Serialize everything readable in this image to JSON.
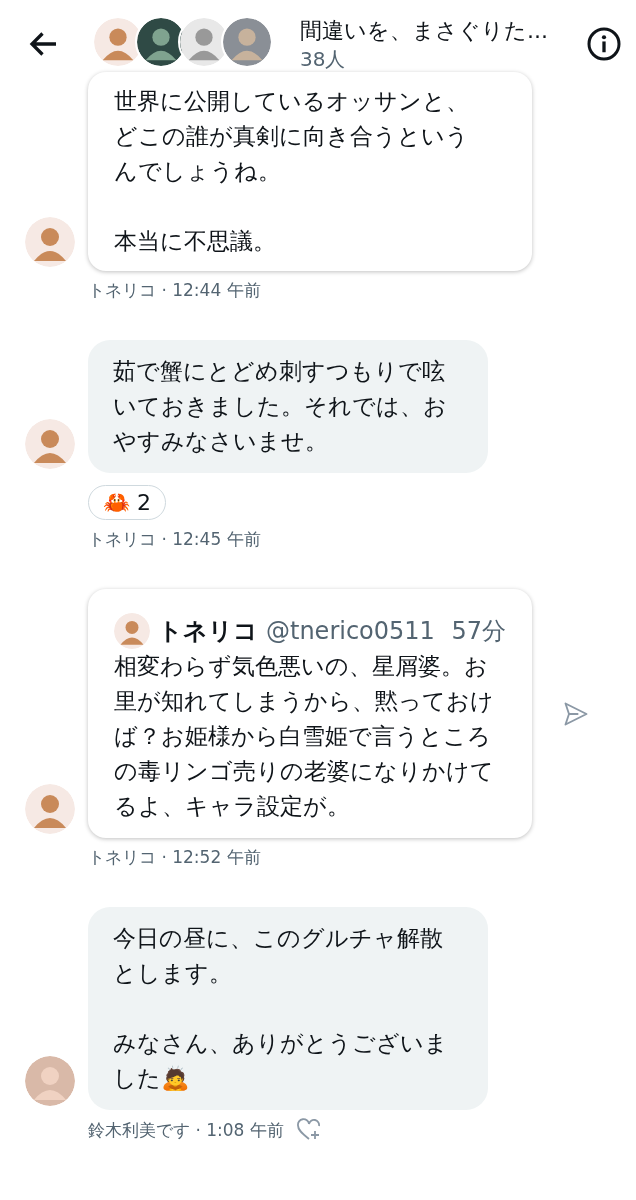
{
  "header": {
    "title": "間違いを、まさぐりた...",
    "member_count": "38人"
  },
  "messages": [
    {
      "kind": "card",
      "paragraphs": [
        "世界に公開しているオッサンと、どこの誰が真剣に向き合うというんでしょうね。",
        "本当に不思議。"
      ],
      "meta": "トネリコ · 12:44 午前",
      "can_react": false
    },
    {
      "kind": "bubble",
      "paragraphs": [
        "茹で蟹にとどめ刺すつもりで呟いておきました。それでは、おやすみなさいませ。"
      ],
      "reactions": [
        {
          "emoji": "🦀",
          "count": "2"
        }
      ],
      "meta": "トネリコ · 12:45 午前",
      "can_react": false
    },
    {
      "kind": "tweet",
      "tweet": {
        "author": "トネリコ",
        "handle": "@tnerico0511",
        "time": "57分",
        "text": "相変わらず気色悪いの、星屑婆。お里が知れてしまうから、黙っておけば？お姫様から白雪姫で言うところの毒リンゴ売りの老婆になりかけてるよ、キャラ設定が。"
      },
      "meta": "トネリコ · 12:52 午前",
      "can_react": false
    },
    {
      "kind": "bubble",
      "paragraphs": [
        "今日の昼に、このグルチャ解散とします。",
        "みなさん、ありがとうございました🙇"
      ],
      "meta": "鈴木利美です · 1:08 午前",
      "can_react": true
    }
  ]
}
